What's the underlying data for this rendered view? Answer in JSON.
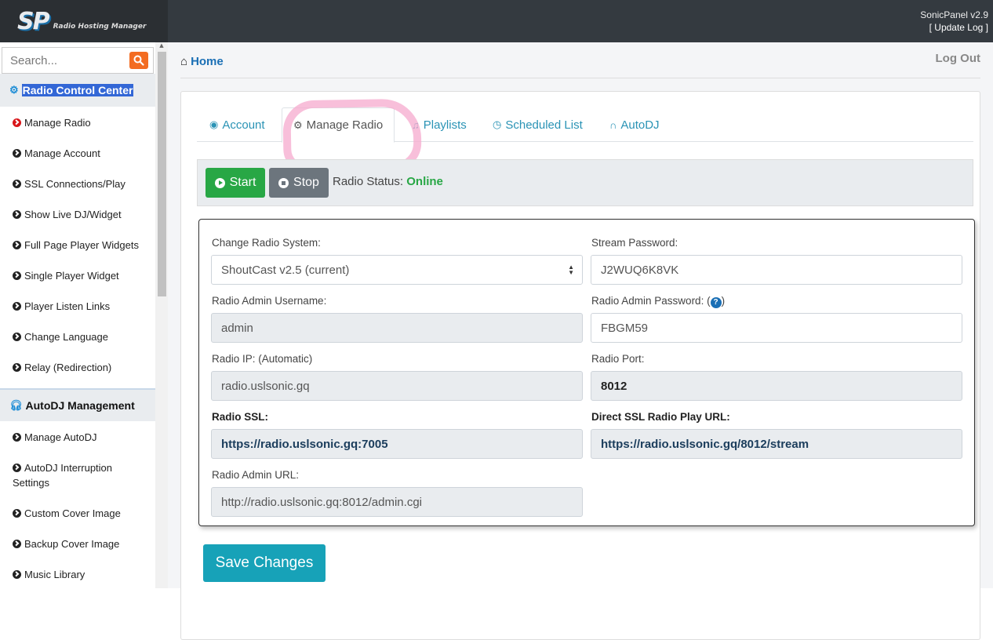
{
  "header": {
    "logo_mark": "SP",
    "logo_text": "Radio Hosting Manager",
    "version": "SonicPanel v2.9",
    "update_log": "[ Update Log ]"
  },
  "sidebar": {
    "search_placeholder": "Search...",
    "section_radio": "Radio Control Center",
    "radio_items": [
      {
        "label": "Manage Radio"
      },
      {
        "label": "Manage Account"
      },
      {
        "label": "SSL Connections/Play"
      },
      {
        "label": "Show Live DJ/Widget"
      },
      {
        "label": "Full Page Player Widgets"
      },
      {
        "label": "Single Player Widget"
      },
      {
        "label": "Player Listen Links"
      },
      {
        "label": "Change Language"
      },
      {
        "label": "Relay (Redirection)"
      }
    ],
    "section_autodj": "AutoDJ Management",
    "autodj_items": [
      {
        "label": "Manage AutoDJ"
      },
      {
        "label": "AutoDJ Interruption Settings"
      },
      {
        "label": "Custom Cover Image"
      },
      {
        "label": "Backup Cover Image"
      },
      {
        "label": "Music Library"
      }
    ]
  },
  "breadcrumb": {
    "home": "Home"
  },
  "logout": "Log Out",
  "tabs": [
    {
      "label": "Account",
      "icon": "user-circle-icon"
    },
    {
      "label": "Manage Radio",
      "icon": "gear-icon"
    },
    {
      "label": "Playlists",
      "icon": "music-note-icon"
    },
    {
      "label": "Scheduled List",
      "icon": "clock-icon"
    },
    {
      "label": "AutoDJ",
      "icon": "headphones-icon"
    }
  ],
  "controls": {
    "start": "Start",
    "stop": "Stop",
    "status_label": "Radio Status:",
    "status_value": "Online"
  },
  "form": {
    "system_label": "Change Radio System:",
    "system_value": "ShoutCast v2.5 (current)",
    "stream_pw_label": "Stream Password:",
    "stream_pw_value": "J2WUQ6K8VK",
    "admin_user_label": "Radio Admin Username:",
    "admin_user_value": "admin",
    "admin_pw_label": "Radio Admin Password: (",
    "admin_pw_label_end": ")",
    "help_glyph": "?",
    "admin_pw_value": "FBGM59",
    "ip_label": "Radio IP: (Automatic)",
    "ip_value": "radio.uslsonic.gq",
    "port_label": "Radio Port:",
    "port_value": "8012",
    "ssl_label": "Radio SSL:",
    "ssl_value": "https://radio.uslsonic.gq:7005",
    "direct_label": "Direct SSL Radio Play URL:",
    "direct_value": "https://radio.uslsonic.gq/8012/stream",
    "admin_url_label": "Radio Admin URL:",
    "admin_url_value": "http://radio.uslsonic.gq:8012/admin.cgi"
  },
  "save_label": "Save Changes",
  "colors": {
    "topbar": "#343a40",
    "link": "#2a93b5",
    "start": "#28a745",
    "stop": "#6c757d",
    "save": "#17a2b8",
    "online": "#28a745",
    "search_button": "#f36c21"
  }
}
